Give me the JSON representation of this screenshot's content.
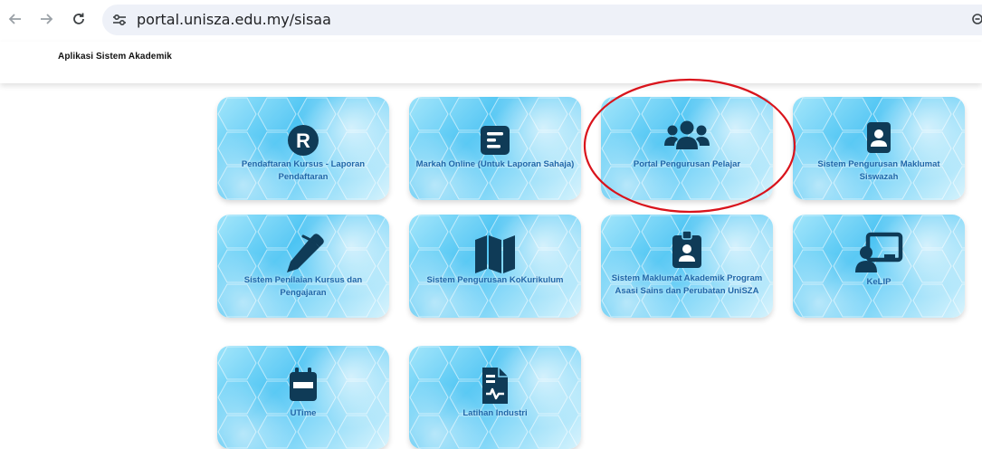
{
  "browser": {
    "url": "portal.unisza.edu.my/sisaa"
  },
  "app": {
    "title": "Aplikasi Sistem Akademik"
  },
  "tiles": [
    {
      "label": "Pendaftaran Kursus - Laporan Pendaftaran",
      "icon": "r-circle-icon"
    },
    {
      "label": "Markah Online (Untuk Laporan Sahaja)",
      "icon": "document-lines-icon"
    },
    {
      "label": "Portal Pengurusan Pelajar",
      "icon": "users-group-icon",
      "highlighted": true
    },
    {
      "label": "Sistem Pengurusan Maklumat Siswazah",
      "icon": "user-card-icon"
    },
    {
      "label": "Sistem Penilaian Kursus dan Pengajaran",
      "icon": "pen-icon"
    },
    {
      "label": "Sistem Pengurusan KoKurikulum",
      "icon": "map-icon"
    },
    {
      "label": "Sistem Maklumat Akademik Program Asasi Sains dan Perubatan UniSZA",
      "icon": "id-badge-icon"
    },
    {
      "label": "KeLIP",
      "icon": "teacher-board-icon"
    },
    {
      "label": "UTime",
      "icon": "calendar-icon"
    },
    {
      "label": "Latihan Industri",
      "icon": "file-medical-icon"
    }
  ],
  "colors": {
    "icon": "#0f3b57",
    "label": "#1f66a8",
    "highlight_ring": "#d9141c"
  }
}
